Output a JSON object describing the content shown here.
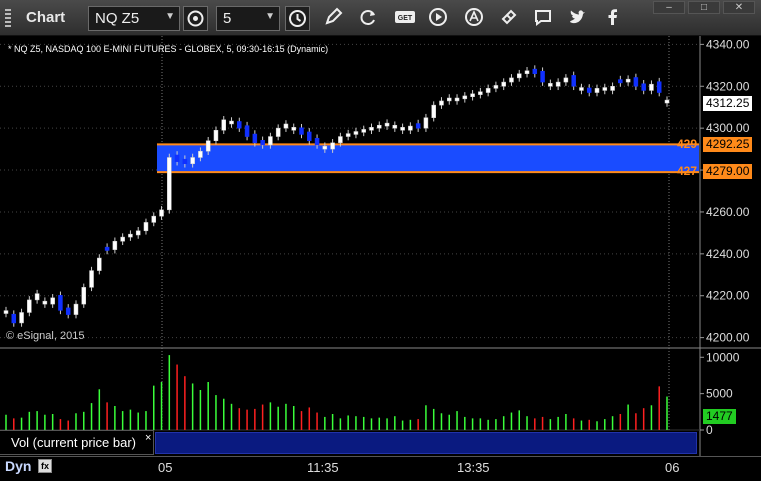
{
  "toolbar": {
    "title": "Chart",
    "symbol": "NQ Z5",
    "interval": "5",
    "icons": [
      "symbol-search-icon",
      "clock-icon",
      "pencil-icon",
      "refresh-icon",
      "get-icon",
      "play-icon",
      "alert-icon",
      "link-icon",
      "comment-icon",
      "twitter-icon",
      "facebook-icon"
    ],
    "get_label": "GET"
  },
  "chart": {
    "label": "* NQ Z5, NASDAQ 100 E-MINI FUTURES - GLOBEX, 5, 09:30-16:15 (Dynamic)",
    "copyright": "© eSignal, 2015",
    "current_price": "4312.25",
    "band_top_tag": "4292.25",
    "band_bottom_tag": "4279.00",
    "band_top_left": "429",
    "band_bottom_left": "427",
    "vol_value": "1477",
    "vol_label": "Vol (current price bar)",
    "vol_close": "×",
    "dyn_label": "Dyn",
    "time_ticks": [
      "05",
      "11:35",
      "13:35",
      "06"
    ],
    "colors": {
      "up": "#ffffff",
      "down": "#1030ff",
      "band": "#1a4cff",
      "band_line": "#ff8a1a",
      "vol_up": "#3aff3a",
      "vol_down": "#ff2020",
      "vol_tag": "#22cc22"
    }
  },
  "chart_data": {
    "type": "candlestick",
    "price_axis": {
      "ticks": [
        4200,
        4220,
        4240,
        4260,
        4280,
        4300,
        4320,
        4340
      ],
      "range": [
        4196,
        4344
      ]
    },
    "volume_axis": {
      "ticks": [
        0,
        5000,
        10000
      ],
      "range": [
        0,
        11000
      ]
    },
    "band": {
      "top": 4292.25,
      "bottom": 4279.0
    },
    "close_path": [
      4210,
      4207,
      4212,
      4218,
      4221,
      4216,
      4219,
      4213,
      4211,
      4216,
      4224,
      4232,
      4238,
      4242,
      4246,
      4248,
      4249,
      4251,
      4255,
      4258,
      4261,
      4286,
      4284,
      4283,
      4286,
      4289,
      4294,
      4299,
      4304,
      4302,
      4300,
      4296,
      4293,
      4292,
      4296,
      4300,
      4302,
      4299,
      4297,
      4294,
      4292,
      4290,
      4293,
      4296,
      4297,
      4298,
      4299,
      4300,
      4301,
      4301,
      4300,
      4299,
      4301,
      4300,
      4305,
      4311,
      4313,
      4313,
      4314,
      4315,
      4316,
      4317,
      4319,
      4320,
      4322,
      4324,
      4326,
      4327,
      4326,
      4322,
      4320,
      4322,
      4324,
      4320,
      4318,
      4317,
      4319,
      4318,
      4320,
      4322,
      4323,
      4320,
      4318,
      4321,
      4317,
      4312
    ],
    "down_bars": [
      1,
      7,
      8,
      13,
      22,
      23,
      30,
      31,
      32,
      33,
      38,
      39,
      40,
      53,
      68,
      69,
      73,
      75,
      79,
      81,
      82,
      84
    ],
    "volume": [
      2100,
      1600,
      1700,
      2500,
      2600,
      2100,
      2200,
      1500,
      1300,
      2300,
      2500,
      3700,
      5600,
      3800,
      3300,
      2600,
      2800,
      2400,
      2600,
      6100,
      6600,
      10300,
      9000,
      7400,
      6400,
      5500,
      6600,
      4800,
      4300,
      3600,
      3000,
      2800,
      2900,
      3500,
      3800,
      3200,
      3600,
      3300,
      2600,
      3100,
      2400,
      1800,
      2200,
      1600,
      2000,
      1900,
      1800,
      1600,
      1700,
      1600,
      1900,
      1300,
      1400,
      1500,
      3400,
      2900,
      2300,
      2100,
      2600,
      1800,
      1600,
      1600,
      1400,
      1500,
      1900,
      2400,
      2700,
      1900,
      1600,
      1800,
      1500,
      1800,
      2200,
      1600,
      1300,
      1400,
      1200,
      1500,
      1900,
      2200,
      3500,
      2300,
      3000,
      3400,
      6000,
      4600
    ]
  }
}
